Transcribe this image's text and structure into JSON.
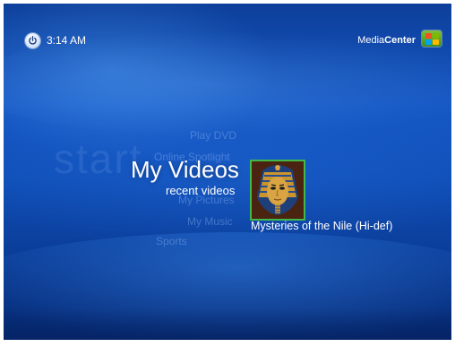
{
  "header": {
    "time": "3:14 AM",
    "brand_part1": "Media",
    "brand_part2": "Center"
  },
  "background_word": "start",
  "menu": {
    "ghost_items": [
      "Play DVD",
      "Online Spotlight",
      "My Pictures",
      "My Music",
      "Sports"
    ],
    "selected_title": "My Videos",
    "selected_subtitle": "recent videos"
  },
  "recent_video": {
    "caption": "Mysteries of the Nile (Hi-def)"
  },
  "colors": {
    "background_top": "#0d3f9a",
    "background_mid": "#1557c4",
    "background_bottom": "#062a73",
    "focus_border": "#41b94a",
    "text": "#ffffff"
  },
  "icons": [
    "power-icon",
    "windows-flag-icon"
  ]
}
